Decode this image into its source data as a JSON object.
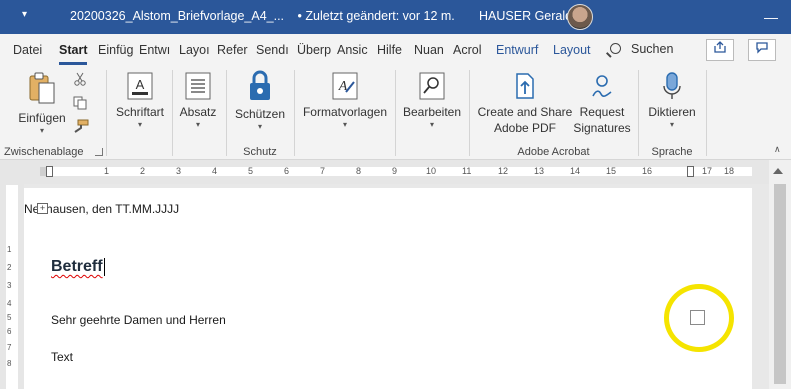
{
  "titlebar": {
    "title": "20200326_Alstom_Briefvorlage_A4_...",
    "saved": "•  Zuletzt geändert: vor 12 m.",
    "user": "HAUSER Gerald",
    "minimize": "—",
    "more": "▾"
  },
  "tabs": [
    "Datei",
    "Start",
    "Einfüg",
    "Entwı",
    "Layoı",
    "Refer",
    "Sendı",
    "Überp",
    "Ansic",
    "Hilfe",
    "Nuan",
    "Acrol",
    "Entwurf",
    "Layout"
  ],
  "search_label": "Suchen",
  "ribbon": {
    "clipboard": {
      "paste": "Einfügen",
      "group": "Zwischenablage"
    },
    "font": {
      "label": "Schriftart"
    },
    "paragraph": {
      "label": "Absatz"
    },
    "protect": {
      "label": "Schützen",
      "group": "Schutz"
    },
    "styles": {
      "label": "Formatvorlagen"
    },
    "editing": {
      "label": "Bearbeiten"
    },
    "acrobat": {
      "create_line1": "Create and Share",
      "create_line2": "Adobe PDF",
      "request_line1": "Request",
      "request_line2": "Signatures",
      "group": "Adobe Acrobat"
    },
    "voice": {
      "label": "Diktieren",
      "group": "Sprache"
    }
  },
  "ruler_numbers": [
    "1",
    "2",
    "3",
    "4",
    "5",
    "6",
    "7",
    "8",
    "9",
    "10",
    "11",
    "12",
    "13",
    "14",
    "15",
    "16",
    "17",
    "18"
  ],
  "vruler_numbers": [
    "1",
    "2",
    "3",
    "4",
    "5",
    "6",
    "7",
    "8"
  ],
  "document": {
    "address_line": "Neuhausen, den TT.MM.JJJJ",
    "subject": "Betreff",
    "salutation": "Sehr geehrte Damen und Herren",
    "body": "Text"
  },
  "colors": {
    "word_blue": "#2b579a",
    "highlight": "#f5e400"
  }
}
